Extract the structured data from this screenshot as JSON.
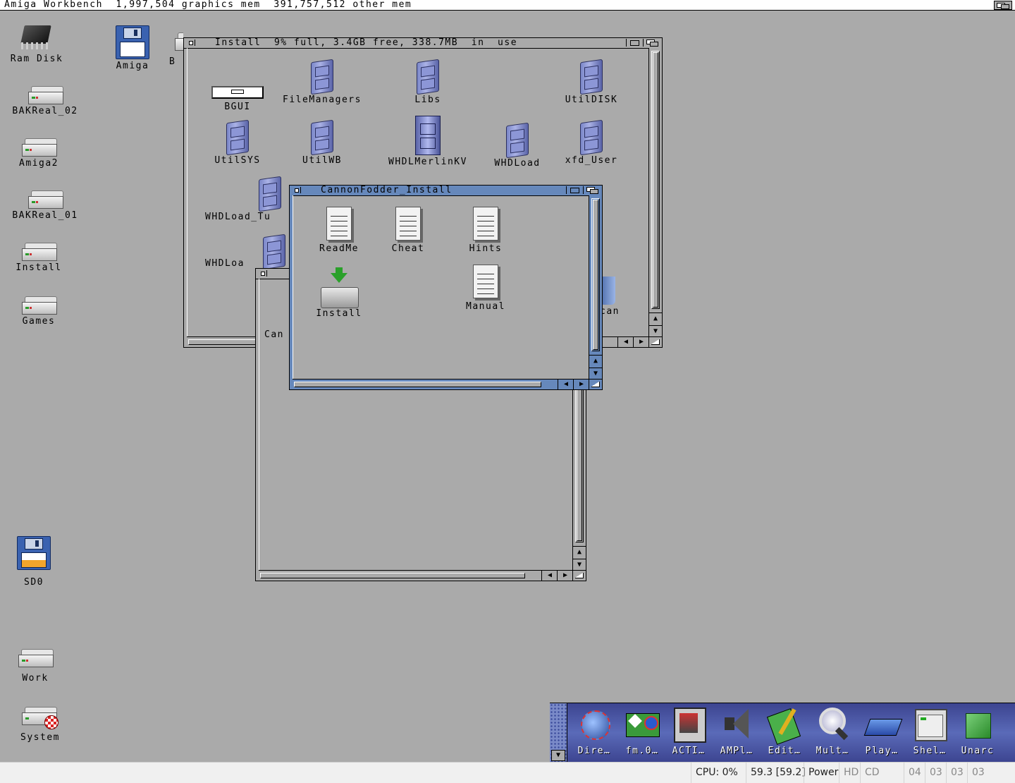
{
  "screen": {
    "title": "Amiga Workbench  1,997,504 graphics mem  391,757,512 other mem"
  },
  "desktop_icons": [
    {
      "label": "Ram Disk",
      "icon": "ram-chip-icon"
    },
    {
      "label": "Amiga",
      "icon": "floppy-icon"
    },
    {
      "label": "B",
      "icon": "hard-disk-icon"
    },
    {
      "label": "BAKReal_02",
      "icon": "hard-disk-icon"
    },
    {
      "label": "Amiga2",
      "icon": "hard-disk-icon"
    },
    {
      "label": "BAKReal_01",
      "icon": "hard-disk-icon"
    },
    {
      "label": "Install",
      "icon": "hard-disk-icon"
    },
    {
      "label": "Games",
      "icon": "hard-disk-icon"
    },
    {
      "label": "SD0",
      "icon": "floppy-icon"
    },
    {
      "label": "Work",
      "icon": "hard-disk-icon"
    },
    {
      "label": "System",
      "icon": "system-disk-icon"
    }
  ],
  "install_window": {
    "title": "Install  9% full, 3.4GB free, 338.7MB  in  use",
    "icons": [
      {
        "label": "BGUI",
        "icon": "bgui-icon"
      },
      {
        "label": "FileManagers",
        "icon": "drawer-icon"
      },
      {
        "label": "Libs",
        "icon": "drawer-icon"
      },
      {
        "label": "UtilDISK",
        "icon": "drawer-icon"
      },
      {
        "label": "UtilSYS",
        "icon": "drawer-icon"
      },
      {
        "label": "UtilWB",
        "icon": "drawer-icon"
      },
      {
        "label": "WHDLMerlinKV",
        "icon": "tall-drawer-icon"
      },
      {
        "label": "WHDLoad",
        "icon": "drawer-icon"
      },
      {
        "label": "xfd_User",
        "icon": "drawer-icon"
      },
      {
        "label": "WHDLoad_Tu",
        "icon": "drawer-icon"
      },
      {
        "label": "WHDLoa",
        "icon": "drawer-icon"
      },
      {
        "label": "can",
        "icon": "trashcan-icon"
      }
    ]
  },
  "back_window": {
    "partial_label": "Can"
  },
  "cannon_window": {
    "title": "CannonFodder_Install",
    "icons": [
      {
        "label": "ReadMe",
        "icon": "document-icon"
      },
      {
        "label": "Cheat",
        "icon": "document-icon"
      },
      {
        "label": "Hints",
        "icon": "document-icon"
      },
      {
        "label": "Install",
        "icon": "installer-icon"
      },
      {
        "label": "Manual",
        "icon": "document-icon"
      }
    ]
  },
  "dock": {
    "items": [
      {
        "label": "Dire…",
        "icon": "directory-opus-icon"
      },
      {
        "label": "fm.0…",
        "icon": "file-manager-icon"
      },
      {
        "label": "ACTI…",
        "icon": "activity-icon"
      },
      {
        "label": "AMPl…",
        "icon": "speaker-icon"
      },
      {
        "label": "Edit…",
        "icon": "notepad-pencil-icon"
      },
      {
        "label": "Mult…",
        "icon": "magnifier-icon"
      },
      {
        "label": "Play…",
        "icon": "player-disc-icon"
      },
      {
        "label": "Shel…",
        "icon": "shell-window-icon"
      },
      {
        "label": "Unarc",
        "icon": "archive-box-icon"
      }
    ]
  },
  "statusbar": {
    "cpu": "CPU: 0%",
    "fps": "59.3 [59.2]",
    "power": "Power",
    "hd": "HD",
    "cd": "CD",
    "drives": [
      "04",
      "03",
      "03",
      "03"
    ]
  }
}
